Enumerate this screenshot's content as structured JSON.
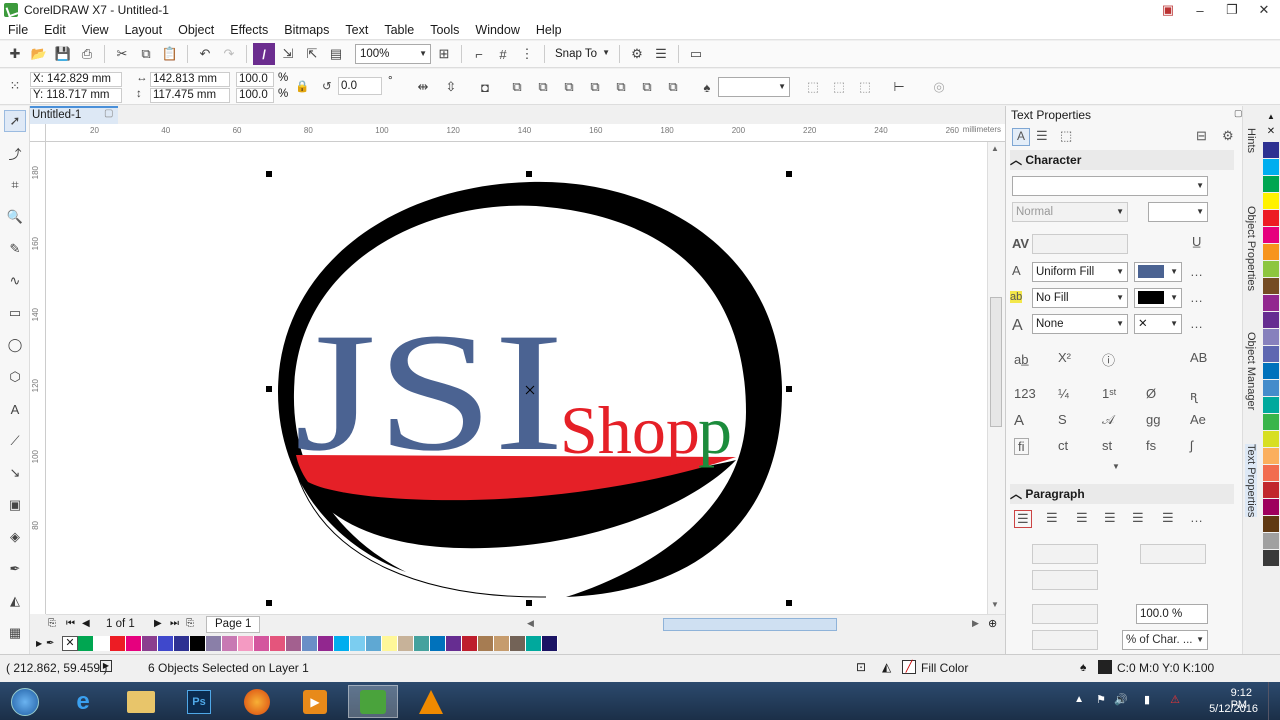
{
  "window": {
    "title": "CorelDRAW X7 - Untitled-1",
    "minimize": "–",
    "restore": "❐",
    "close": "✕"
  },
  "menu": [
    "File",
    "Edit",
    "View",
    "Layout",
    "Object",
    "Effects",
    "Bitmaps",
    "Text",
    "Table",
    "Tools",
    "Window",
    "Help"
  ],
  "toolbar": {
    "zoom": "100%",
    "snap_to": "Snap To"
  },
  "property_bar": {
    "x": "X: 142.829 mm",
    "y": "Y: 118.717 mm",
    "width": "142.813 mm",
    "height": "117.475 mm",
    "scale_x": "100.0",
    "scale_y": "100.0",
    "percent": "%",
    "rotation": "0.0",
    "degree": "°"
  },
  "document": {
    "tab": "Untitled-1",
    "page_count": "1 of 1",
    "page_tab": "Page 1",
    "ruler_unit": "millimeters"
  },
  "ruler": {
    "h_ticks": [
      "20",
      "40",
      "60",
      "80",
      "100",
      "120",
      "140",
      "160",
      "180",
      "200",
      "220",
      "240",
      "260"
    ],
    "v_ticks": [
      "180",
      "160",
      "140",
      "120",
      "100",
      "80"
    ]
  },
  "artwork": {
    "jsi": "JSI",
    "shop": "Shop",
    "colors": {
      "blue": "#4b6392",
      "red": "#e52027",
      "green": "#1c8c3c",
      "black": "#000000"
    }
  },
  "docker": {
    "title": "Text Properties",
    "character": "Character",
    "style": "Normal",
    "fill": "Uniform Fill",
    "bg_fill": "No Fill",
    "outline": "None",
    "paragraph": "Paragraph",
    "line_spacing": "100.0 %",
    "char_spacing_unit": "% of Char. ..."
  },
  "side_tabs": [
    "Hints",
    "Object Properties",
    "Object Manager",
    "Text Properties"
  ],
  "status": {
    "coords": "( 212.862, 59.459 )",
    "selection": "6 Objects Selected on Layer 1",
    "fill_label": "Fill Color",
    "outline_value": "C:0 M:0 Y:0 K:100"
  },
  "tray": {
    "time": "9:12 PM",
    "date": "5/12/2016"
  },
  "palette_colors": [
    "#00a651",
    "#ffffff",
    "#ed1c24",
    "#e6007e",
    "#8b3e8f",
    "#3f48cc",
    "#2e3192",
    "#000000",
    "#8a7fa8",
    "#c879b3",
    "#f49ac2",
    "#d4569e",
    "#e4557c",
    "#a3608f",
    "#6a8fc7",
    "#92278f",
    "#00aeef",
    "#7bcdf0",
    "#5fa8d3",
    "#fff799",
    "#c7b299",
    "#45a29e",
    "#0072bc",
    "#662d91",
    "#be1e2d",
    "#a67c52",
    "#c69c6d",
    "#736357",
    "#00a99d",
    "#1b1464"
  ],
  "side_palette": [
    "#2e3192",
    "#00aeef",
    "#00a651",
    "#fff200",
    "#ed1c24",
    "#e6007e",
    "#f7941d",
    "#8dc63f",
    "#754c24",
    "#92278f",
    "#662d91",
    "#8781bd",
    "#5e67b1",
    "#0072bc",
    "#448ccb",
    "#00a99d",
    "#39b54a",
    "#d7df23",
    "#fbaf5d",
    "#f26c4f",
    "#c1272d",
    "#9e005d",
    "#603913",
    "#a0a0a0",
    "#3a3a3a"
  ]
}
